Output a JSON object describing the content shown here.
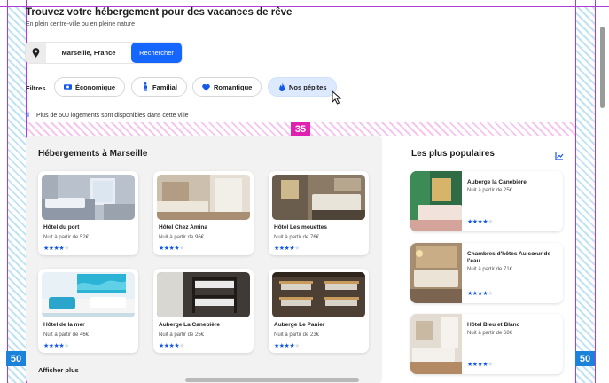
{
  "header": {
    "title": "Trouvez votre hébergement pour des vacances de rêve",
    "subtitle": "En plein centre-ville ou en pleine nature"
  },
  "search": {
    "location": "Marseille, France",
    "button_label": "Rechercher",
    "icon": "map-pin-icon"
  },
  "filters": {
    "label": "Filtres",
    "chips": [
      {
        "label": "Économique",
        "icon": "money-icon",
        "selected": false
      },
      {
        "label": "Familial",
        "icon": "person-icon",
        "selected": false
      },
      {
        "label": "Romantique",
        "icon": "heart-icon",
        "selected": false
      },
      {
        "label": "Nos pépites",
        "icon": "flame-icon",
        "selected": true
      }
    ]
  },
  "info": {
    "text": "Plus de 500 logements sont disponibles dans cette ville"
  },
  "spacing_annotations": {
    "left_margin": "50",
    "right_margin": "50",
    "section_gap": "35"
  },
  "accommodations": {
    "title": "Hébergements à Marseille",
    "show_more": "Afficher plus",
    "cards": [
      {
        "name": "Hôtel du port",
        "price": "Nuit à partir de 52€",
        "rating": 4
      },
      {
        "name": "Hôtel Chez Amina",
        "price": "Nuit à partir de 96€",
        "rating": 4
      },
      {
        "name": "Hôtel Les mouettes",
        "price": "Nuit à partir de 76€",
        "rating": 4
      },
      {
        "name": "Hôtel de la mer",
        "price": "Nuit à partir de 46€",
        "rating": 4
      },
      {
        "name": "Auberge La Canebière",
        "price": "Nuit à partir de 25€",
        "rating": 4
      },
      {
        "name": "Auberge Le Panier",
        "price": "Nuit à partir de 23€",
        "rating": 4
      }
    ]
  },
  "popular": {
    "title": "Les plus populaires",
    "icon": "trend-chart-icon",
    "cards": [
      {
        "name": "Auberge la Canebière",
        "price": "Nuit à partir de 25€",
        "rating": 4
      },
      {
        "name": "Chambres d'hôtes Au cœur de l'eau",
        "price": "Nuit à partir de 71€",
        "rating": 4
      },
      {
        "name": "Hôtel Bleu et Blanc",
        "price": "Nuit à partir de 68€",
        "rating": 4
      }
    ]
  },
  "colors": {
    "accent": "#1565ff",
    "star": "#1358e8",
    "panel": "#f2f2f2"
  }
}
